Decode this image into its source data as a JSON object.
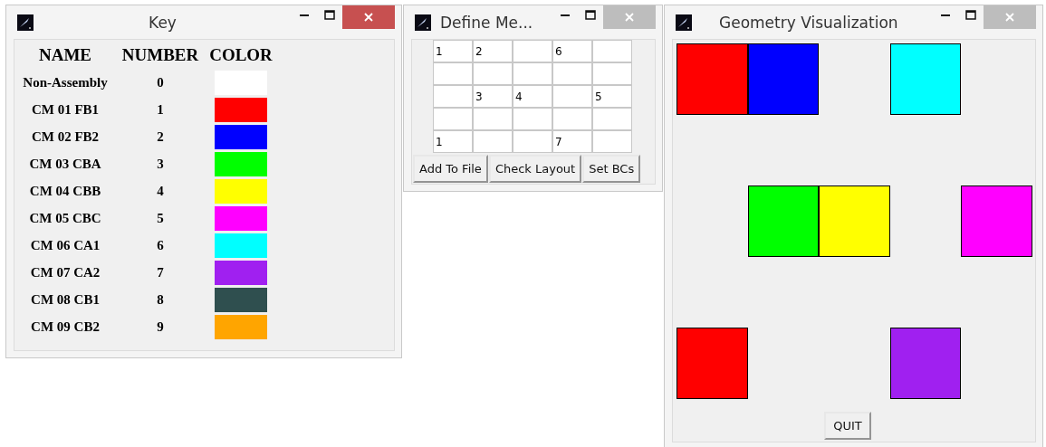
{
  "key_window": {
    "title": "Key",
    "active": true,
    "columns": [
      "NAME",
      "NUMBER",
      "COLOR"
    ],
    "rows": [
      {
        "name": "Non-Assembly",
        "number": "0",
        "color": "#ffffff"
      },
      {
        "name": "CM 01 FB1",
        "number": "1",
        "color": "#ff0000"
      },
      {
        "name": "CM 02 FB2",
        "number": "2",
        "color": "#0000ff"
      },
      {
        "name": "CM 03 CBA",
        "number": "3",
        "color": "#00ff00"
      },
      {
        "name": "CM 04 CBB",
        "number": "4",
        "color": "#ffff00"
      },
      {
        "name": "CM 05 CBC",
        "number": "5",
        "color": "#ff00ff"
      },
      {
        "name": "CM 06 CA1",
        "number": "6",
        "color": "#00ffff"
      },
      {
        "name": "CM 07 CA2",
        "number": "7",
        "color": "#a020f0"
      },
      {
        "name": "CM 08 CB1",
        "number": "8",
        "color": "#2f4f4f"
      },
      {
        "name": "CM 09 CB2",
        "number": "9",
        "color": "#ffa500"
      }
    ]
  },
  "define_window": {
    "title": "Define Me...",
    "active": false,
    "grid": [
      [
        {
          "kind": "value",
          "value": "1"
        },
        {
          "kind": "value",
          "value": "2"
        },
        {
          "kind": "empty"
        },
        {
          "kind": "value",
          "value": "6"
        },
        {
          "kind": "empty"
        }
      ],
      [
        {
          "kind": "empty"
        },
        {
          "kind": "empty"
        },
        {
          "kind": "empty"
        },
        {
          "kind": "empty"
        },
        {
          "kind": "empty"
        }
      ],
      [
        {
          "kind": "empty"
        },
        {
          "kind": "value",
          "value": "3"
        },
        {
          "kind": "value",
          "value": "4"
        },
        {
          "kind": "empty"
        },
        {
          "kind": "value",
          "value": "5"
        }
      ],
      [
        {
          "kind": "empty"
        },
        {
          "kind": "empty"
        },
        {
          "kind": "empty"
        },
        {
          "kind": "empty"
        },
        {
          "kind": "empty"
        }
      ],
      [
        {
          "kind": "value",
          "value": "1"
        },
        {
          "kind": "empty"
        },
        {
          "kind": "empty"
        },
        {
          "kind": "value",
          "value": "7"
        },
        {
          "kind": "empty"
        }
      ]
    ],
    "buttons": [
      "Add To File",
      "Check Layout",
      "Set BCs"
    ]
  },
  "geometry_window": {
    "title": "Geometry Visualization",
    "active": false,
    "grid": [
      [
        {
          "kind": "block",
          "color": "#ff0000"
        },
        {
          "kind": "block",
          "color": "#0000ff"
        },
        {
          "kind": "empty"
        },
        {
          "kind": "block",
          "color": "#00ffff"
        },
        {
          "kind": "empty"
        }
      ],
      [
        {
          "kind": "empty"
        },
        {
          "kind": "empty"
        },
        {
          "kind": "empty"
        },
        {
          "kind": "empty"
        },
        {
          "kind": "empty"
        }
      ],
      [
        {
          "kind": "empty"
        },
        {
          "kind": "block",
          "color": "#00ff00"
        },
        {
          "kind": "block",
          "color": "#ffff00"
        },
        {
          "kind": "empty"
        },
        {
          "kind": "block",
          "color": "#ff00ff"
        }
      ],
      [
        {
          "kind": "empty"
        },
        {
          "kind": "empty"
        },
        {
          "kind": "empty"
        },
        {
          "kind": "empty"
        },
        {
          "kind": "empty"
        }
      ],
      [
        {
          "kind": "block",
          "color": "#ff0000"
        },
        {
          "kind": "empty"
        },
        {
          "kind": "empty"
        },
        {
          "kind": "block",
          "color": "#a020f0"
        },
        {
          "kind": "empty"
        }
      ]
    ],
    "quit_button": "QUIT"
  }
}
